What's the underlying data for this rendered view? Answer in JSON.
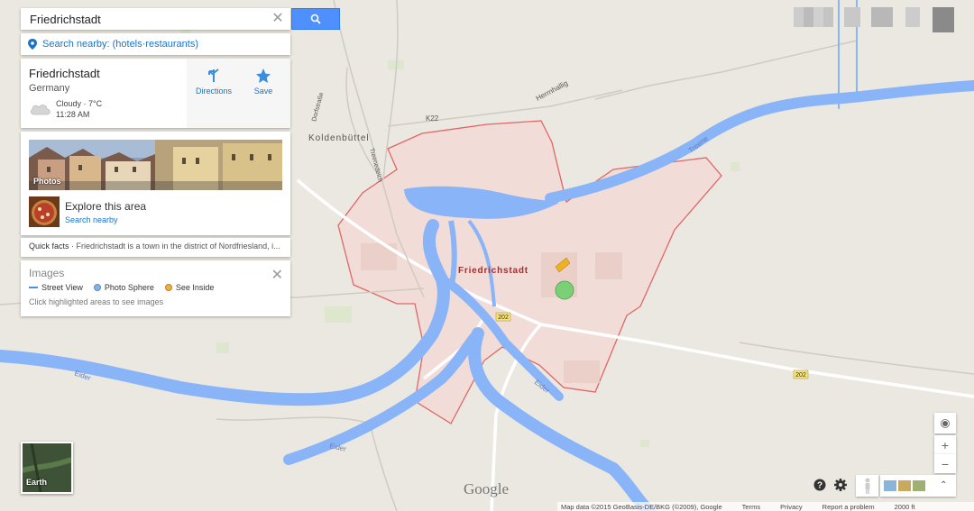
{
  "search": {
    "value": "Friedrichstadt",
    "clear_icon": "close-icon",
    "button_icon": "search-icon"
  },
  "nearby": {
    "label": "Search nearby:",
    "options": "(hotels·restaurants)"
  },
  "place": {
    "title": "Friedrichstadt",
    "country": "Germany",
    "weather": "Cloudy · 7°C",
    "time": "11:28 AM",
    "directions_label": "Directions",
    "save_label": "Save"
  },
  "photos": {
    "label": "Photos",
    "explore_title": "Explore this area",
    "explore_link": "Search nearby"
  },
  "quick_facts": {
    "label": "Quick facts",
    "text": " · Friedrichstadt is a town in the district of Nordfriesland, i..."
  },
  "images": {
    "title": "Images",
    "legend": [
      "Street View",
      "Photo Sphere",
      "See Inside"
    ],
    "hint": "Click highlighted areas to see images",
    "legend_colors": [
      "#4a90e2",
      "#8ab4e0",
      "#f0b040"
    ]
  },
  "earth_label": "Earth",
  "map_labels": {
    "koldenbuttel": "Koldenbüttel",
    "friedrichstadt": "Friedrichstadt",
    "k22": "K22",
    "herrnhallig": "Herrnhallig",
    "treene": "Treene",
    "treenedeich": "Treenedeich",
    "dorfstrasse": "Dorfstraße",
    "eider1": "Eider",
    "eider2": "Eider",
    "eider3": "Eider",
    "road202a": "202",
    "road202b": "202"
  },
  "footer": {
    "map_data": "Map data ©2015 GeoBasis-DE/BKG (©2009), Google",
    "terms": "Terms",
    "privacy": "Privacy",
    "report": "Report a problem",
    "scale": "2000 ft"
  },
  "google": "Google",
  "colors": {
    "water": "#8ab4f8",
    "town": "#f2dcd7",
    "border": "#e06060",
    "accent": "#4d90fe",
    "link": "#1a73c8"
  }
}
